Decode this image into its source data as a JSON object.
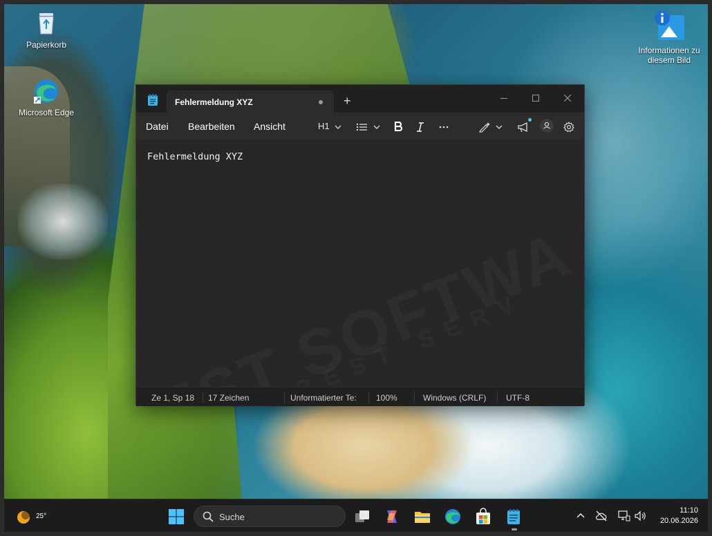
{
  "desktop": {
    "icons": [
      {
        "label": "Papierkorb"
      },
      {
        "label": "Microsoft Edge"
      },
      {
        "label": "Informationen zu diesem Bild"
      }
    ]
  },
  "notepad": {
    "tab_title": "Fehlermeldung XYZ",
    "new_tab_label": "+",
    "menu": [
      "Datei",
      "Bearbeiten",
      "Ansicht"
    ],
    "heading_dropdown": "H1",
    "content": "Fehlermeldung XYZ",
    "watermark": "EST SOFTWA",
    "watermark_sub": "BEST SERV",
    "status": {
      "position": "Ze 1, Sp 18",
      "chars": "17 Zeichen",
      "format": "Unformatierter Te:",
      "zoom": "100%",
      "line_ending": "Windows (CRLF)",
      "encoding": "UTF-8"
    }
  },
  "taskbar": {
    "weather_temp": "25°",
    "search_label": "Suche",
    "time": "11:10",
    "date": "20.06.2026"
  },
  "colors": {
    "window_bg": "#202020",
    "editor_bg": "#272727",
    "taskbar_bg": "#1c1c1c",
    "accent": "#0078d4"
  }
}
